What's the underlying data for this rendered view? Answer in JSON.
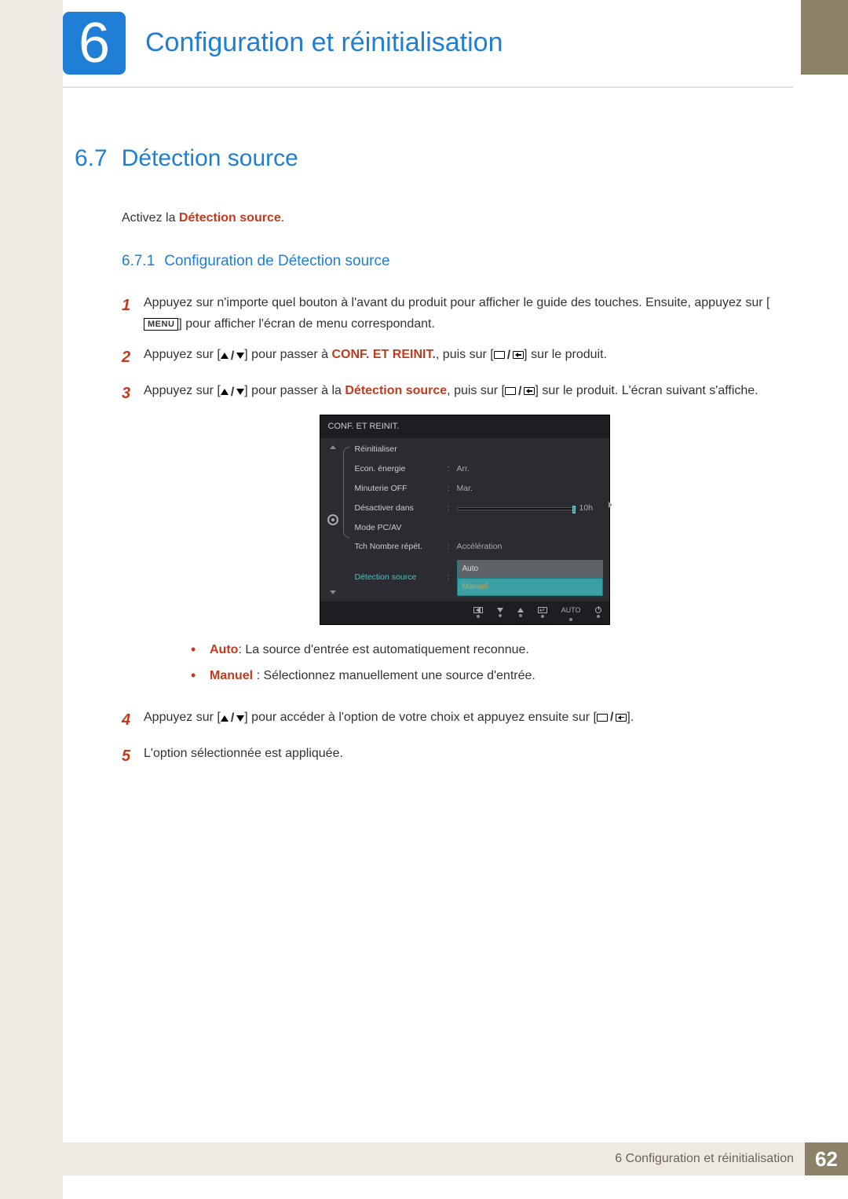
{
  "chapter": {
    "number": "6",
    "title": "Configuration et réinitialisation"
  },
  "section": {
    "number": "6.7",
    "title": "Détection source"
  },
  "intro": {
    "before": "Activez la ",
    "highlight": "Détection source",
    "after": "."
  },
  "subsection": {
    "number": "6.7.1",
    "title": "Configuration de Détection source"
  },
  "steps": {
    "s1": {
      "a": "Appuyez sur n'importe quel bouton à l'avant du produit pour afficher le guide des touches. Ensuite, appuyez sur [",
      "menu": "MENU",
      "b": "] pour afficher l'écran de menu correspondant."
    },
    "s2": {
      "a": "Appuyez sur [",
      "b": "] pour passer à ",
      "target": "CONF. ET REINIT.",
      "c": ", puis sur [",
      "d": "] sur le produit."
    },
    "s3": {
      "a": "Appuyez sur [",
      "b": "] pour passer à la ",
      "target": "Détection source",
      "c": ", puis sur [",
      "d": "] sur le produit. L'écran suivant s'affiche."
    },
    "s4": {
      "a": "Appuyez sur [",
      "b": "] pour accéder à l'option de votre choix et appuyez ensuite sur [",
      "c": "]."
    },
    "s5": {
      "a": "L'option sélectionnée est appliquée."
    }
  },
  "osd": {
    "title": "CONF. ET REINIT.",
    "rows": {
      "reset": "Réinitialiser",
      "eco": {
        "label": "Econ. énergie",
        "value": "Arr."
      },
      "timer": {
        "label": "Minuterie OFF",
        "value": "Mar."
      },
      "off_in": {
        "label": "Désactiver dans",
        "value": "10h"
      },
      "pcav": "Mode PC/AV",
      "repeat": {
        "label": "Tch Nombre répét.",
        "value": "Accélération"
      },
      "source": {
        "label": "Détection source",
        "opt1": "Auto",
        "opt2": "Manuel"
      }
    },
    "footer_auto": "AUTO"
  },
  "bullets": {
    "auto": {
      "label": "Auto",
      "text": ": La source d'entrée est automatiquement reconnue."
    },
    "manual": {
      "label": "Manuel",
      "text": " : Sélectionnez manuellement une source d'entrée."
    }
  },
  "footer": {
    "chapter_num": "6",
    "text": "Configuration et réinitialisation",
    "page": "62"
  }
}
